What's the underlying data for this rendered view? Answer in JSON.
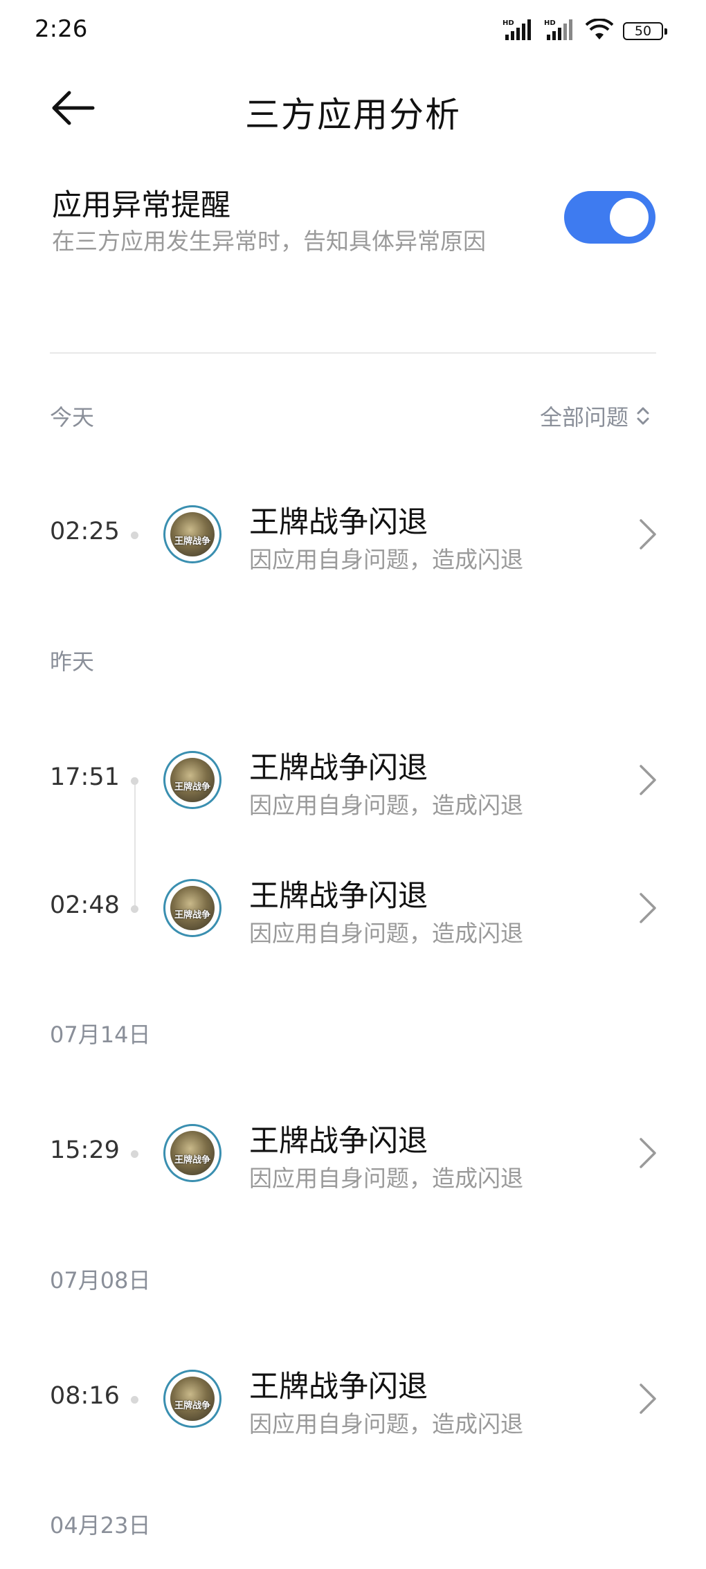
{
  "status_bar": {
    "time": "2:26",
    "battery": "50",
    "signal1_label": "HD",
    "signal2_label": "HD"
  },
  "header": {
    "title": "三方应用分析"
  },
  "setting": {
    "title": "应用异常提醒",
    "subtitle": "在三方应用发生异常时，告知具体异常原因",
    "toggle_on": true,
    "accent": "#3e7bf0"
  },
  "filter": {
    "label": "全部问题"
  },
  "sections": [
    {
      "label": "今天",
      "items": [
        {
          "time": "02:25",
          "title": "王牌战争闪退",
          "subtitle": "因应用自身问题，造成闪退"
        }
      ]
    },
    {
      "label": "昨天",
      "items": [
        {
          "time": "17:51",
          "title": "王牌战争闪退",
          "subtitle": "因应用自身问题，造成闪退"
        },
        {
          "time": "02:48",
          "title": "王牌战争闪退",
          "subtitle": "因应用自身问题，造成闪退"
        }
      ]
    },
    {
      "label": "07月14日",
      "items": [
        {
          "time": "15:29",
          "title": "王牌战争闪退",
          "subtitle": "因应用自身问题，造成闪退"
        }
      ]
    },
    {
      "label": "07月08日",
      "items": [
        {
          "time": "08:16",
          "title": "王牌战争闪退",
          "subtitle": "因应用自身问题，造成闪退"
        }
      ]
    },
    {
      "label": "04月23日",
      "items": []
    }
  ],
  "app_icon": {
    "name": "wangpai-zhanzheng-app-icon",
    "text": "王牌战争"
  }
}
